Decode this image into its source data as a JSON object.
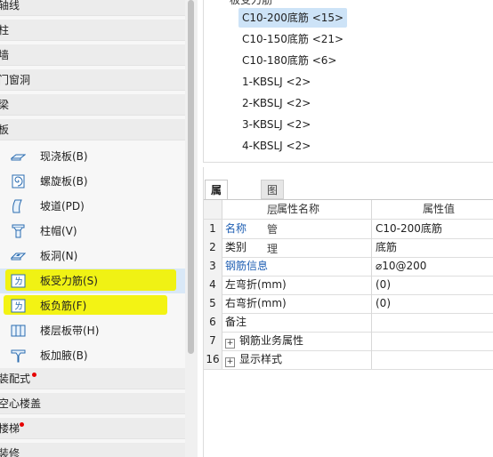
{
  "left_nav": {
    "categories_top": [
      {
        "label": "轴线"
      },
      {
        "label": "柱"
      },
      {
        "label": "墙"
      },
      {
        "label": "门窗洞"
      },
      {
        "label": "梁"
      },
      {
        "label": "板"
      }
    ],
    "sub_items": [
      {
        "label": "现浇板(B)",
        "icon": "cast-slab-icon"
      },
      {
        "label": "螺旋板(B)",
        "icon": "spiral-slab-icon"
      },
      {
        "label": "坡道(PD)",
        "icon": "ramp-icon"
      },
      {
        "label": "柱帽(V)",
        "icon": "column-cap-icon"
      },
      {
        "label": "板洞(N)",
        "icon": "slab-hole-icon"
      },
      {
        "label": "板受力筋(S)",
        "icon": "slab-main-rebar-icon",
        "selected": true
      },
      {
        "label": "板负筋(F)",
        "icon": "slab-negative-rebar-icon"
      },
      {
        "label": "楼层板带(H)",
        "icon": "floor-slab-strip-icon"
      },
      {
        "label": "板加腋(B)",
        "icon": "slab-haunch-icon"
      }
    ],
    "categories_bottom": [
      {
        "label": "装配式",
        "badge": true
      },
      {
        "label": "空心楼盖",
        "badge": false
      },
      {
        "label": "楼梯",
        "badge": true
      },
      {
        "label": "装修",
        "badge": false
      }
    ]
  },
  "tree": {
    "header_fragment": "板受力筋",
    "items": [
      "C10-200底筋 <15>",
      "C10-150底筋 <21>",
      "C10-180底筋 <6>",
      "1-KBSLJ <2>",
      "2-KBSLJ <2>",
      "3-KBSLJ <2>",
      "4-KBSLJ <2>"
    ],
    "selected_index": 0
  },
  "props": {
    "tabs": [
      "属性列表",
      "图层管理"
    ],
    "active_tab": 0,
    "header": {
      "name_col": "属性名称",
      "value_col": "属性值"
    },
    "rows": [
      {
        "num": "1",
        "name": "名称",
        "value": "C10-200底筋",
        "link": true
      },
      {
        "num": "2",
        "name": "类别",
        "value": "底筋",
        "link": false
      },
      {
        "num": "3",
        "name": "钢筋信息",
        "value": "⌀10@200",
        "link": true
      },
      {
        "num": "4",
        "name": "左弯折(mm)",
        "value": "(0)",
        "link": false
      },
      {
        "num": "5",
        "name": "右弯折(mm)",
        "value": "(0)",
        "link": false
      },
      {
        "num": "6",
        "name": "备注",
        "value": "",
        "link": false
      },
      {
        "num": "7",
        "name": "钢筋业务属性",
        "value": "",
        "link": false,
        "expander": "+"
      },
      {
        "num": "16",
        "name": "显示样式",
        "value": "",
        "link": false,
        "expander": "+"
      }
    ]
  },
  "colors": {
    "highlight": "#f2f200",
    "link": "#1f5fb3",
    "selected_row": "#d9e8f7",
    "badge": "#e60000"
  }
}
